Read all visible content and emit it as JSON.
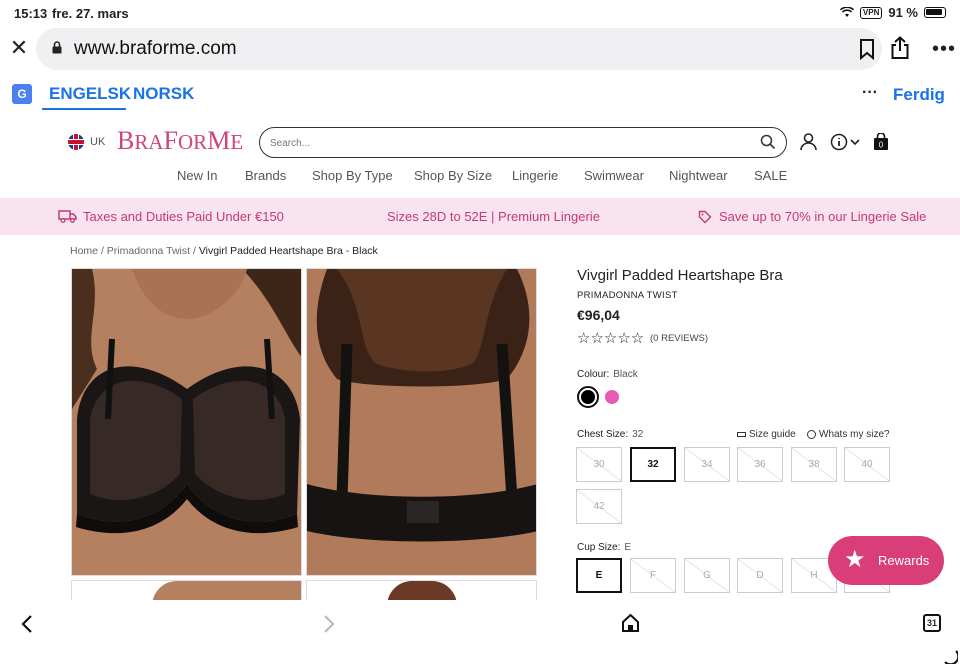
{
  "status_bar": {
    "time": "15:13",
    "date": "fre. 27. mars",
    "vpn": "VPN",
    "battery": "91 %"
  },
  "browser": {
    "url": "www.braforme.com"
  },
  "translate_bar": {
    "langs": [
      "ENGELSK",
      "NORSK"
    ],
    "done": "Ferdig"
  },
  "header": {
    "region": "UK",
    "logo": "BRAFORME",
    "search_placeholder": "Search..."
  },
  "nav": [
    "New In",
    "Brands",
    "Shop By Type",
    "Shop By Size",
    "Lingerie",
    "Swimwear",
    "Nightwear",
    "SALE"
  ],
  "promo": [
    "Taxes and Duties Paid Under €150",
    "Sizes 28D to 52E | Premium Lingerie",
    "Save up to 70% in our Lingerie Sale"
  ],
  "breadcrumb": {
    "items": [
      "Home",
      "Primadonna Twist"
    ],
    "current": "Vivgirl Padded Heartshape Bra - Black",
    "sep": "/"
  },
  "product": {
    "title": "Vivgirl Padded Heartshape Bra",
    "brand": "PRIMADONNA TWIST",
    "price": "€96,04",
    "stars": "☆☆☆☆☆",
    "reviews": "(0 REVIEWS)",
    "colour_label": "Colour:",
    "colour_value": "Black",
    "colours": [
      "#000000",
      "#e85bb5"
    ],
    "chest_label": "Chest Size:",
    "chest_value": "32",
    "chest_sizes": [
      "30",
      "32",
      "34",
      "36",
      "38",
      "40",
      "42"
    ],
    "size_guide": "Size guide",
    "whats_my_size": "Whats my size?",
    "cup_label": "Cup Size:",
    "cup_value": "E",
    "cup_sizes": [
      "E",
      "F",
      "G",
      "D",
      "H",
      ""
    ]
  },
  "rewards": {
    "label": "Rewards"
  },
  "toolbar": {
    "tabs_count": "31"
  }
}
